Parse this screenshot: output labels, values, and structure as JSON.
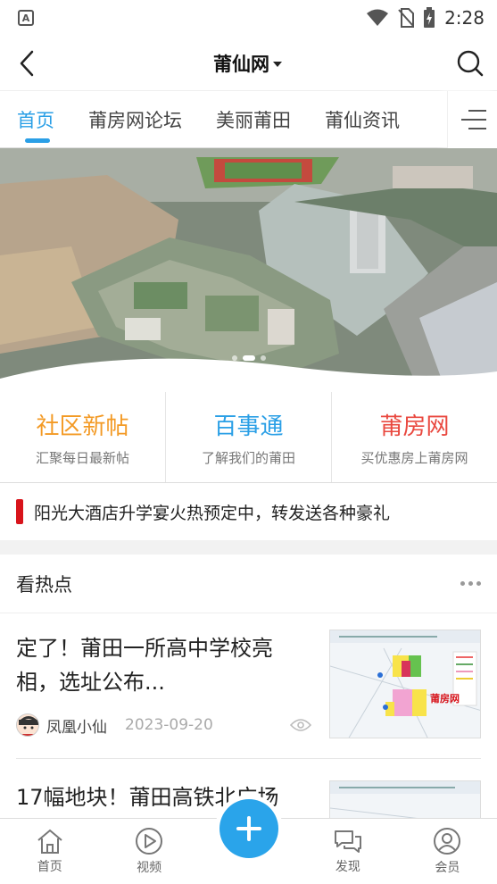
{
  "status_bar": {
    "time": "2:28",
    "notification_letter": "A"
  },
  "header": {
    "title": "莆仙网"
  },
  "tabs": [
    {
      "label": "首页",
      "active": true
    },
    {
      "label": "莆房网论坛",
      "active": false
    },
    {
      "label": "美丽莆田",
      "active": false
    },
    {
      "label": "莆仙资讯",
      "active": false
    }
  ],
  "features": [
    {
      "title": "社区新帖",
      "subtitle": "汇聚每日最新帖",
      "color": "#f39a25"
    },
    {
      "title": "百事通",
      "subtitle": "了解我们的莆田",
      "color": "#2a9fe6"
    },
    {
      "title": "莆房网",
      "subtitle": "买优惠房上莆房网",
      "color": "#e9483f"
    }
  ],
  "notice": {
    "text": "阳光大酒店升学宴火热预定中，转发送各种豪礼",
    "accent": "#d8141b"
  },
  "section": {
    "title": "看热点"
  },
  "articles": [
    {
      "title": "定了！莆田一所高中学校亮相，选址公布...",
      "author": "凤凰小仙",
      "date": "2023-09-20",
      "thumb_label": "莆房网"
    },
    {
      "title": "17幅地块！莆田高铁北广场"
    }
  ],
  "bottom_nav": [
    {
      "label": "首页"
    },
    {
      "label": "视频"
    },
    {
      "label": "发现"
    },
    {
      "label": "会员"
    }
  ],
  "colors": {
    "accent": "#2a9fe6",
    "plus_button": "#2aa4ea"
  }
}
